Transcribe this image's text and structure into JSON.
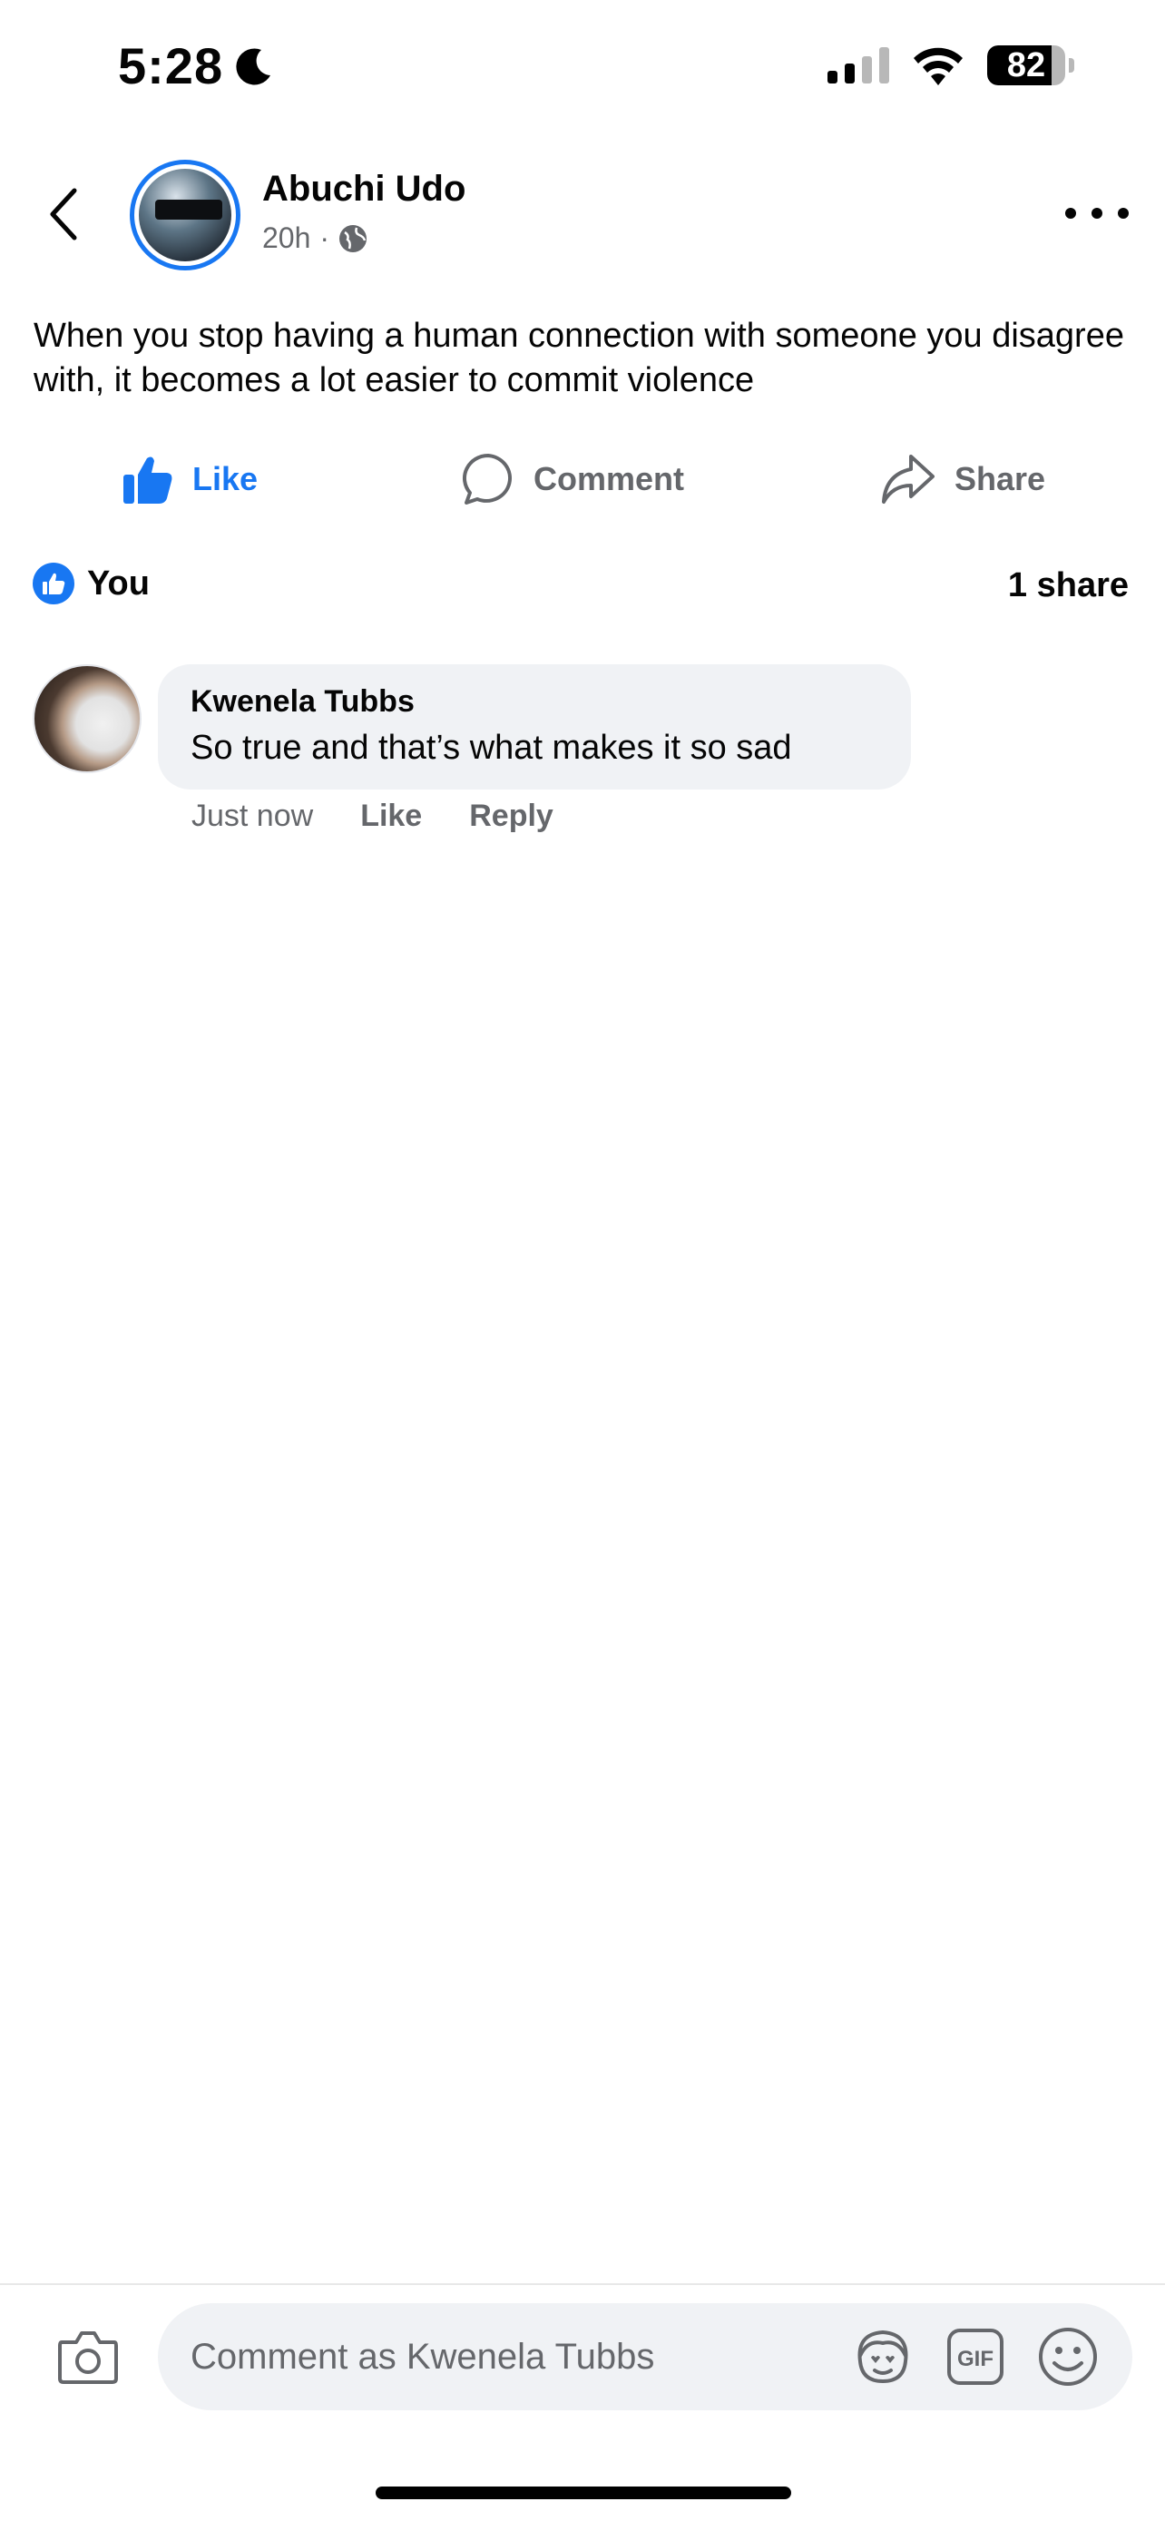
{
  "status_bar": {
    "time": "5:28",
    "battery_level": "82",
    "battery_fraction": 0.82
  },
  "post": {
    "author": "Abuchi Udo",
    "age": "20h",
    "separator": "·",
    "text": "When you stop having a human connection with someone you disagree with, it becomes a lot easier to commit violence"
  },
  "actions": {
    "like": "Like",
    "comment": "Comment",
    "share": "Share"
  },
  "reactions": {
    "who": "You",
    "shares": "1 share"
  },
  "comment": {
    "author": "Kwenela Tubbs",
    "text": "So true and that’s what makes it so sad",
    "time": "Just now",
    "like": "Like",
    "reply": "Reply"
  },
  "composer": {
    "placeholder": "Comment as Kwenela Tubbs",
    "gif_label": "GIF"
  },
  "colors": {
    "accent": "#1877f2",
    "secondary_text": "#65676b",
    "bubble": "#f0f2f5"
  }
}
